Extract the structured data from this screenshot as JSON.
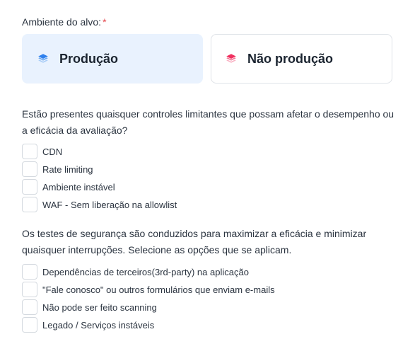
{
  "environment": {
    "label": "Ambiente do alvo:",
    "required_mark": "*",
    "options": [
      {
        "title": "Produção",
        "selected": true,
        "icon": "layers-icon",
        "icon_color": "#2f80ed"
      },
      {
        "title": "Não produção",
        "selected": false,
        "icon": "layers-icon",
        "icon_color": "#f0305f"
      }
    ]
  },
  "limiting_controls": {
    "question": "Estão presentes quaisquer controles limitantes que possam afetar o desempenho ou a eficácia da avaliação?",
    "options": [
      {
        "label": "CDN",
        "checked": false
      },
      {
        "label": "Rate limiting",
        "checked": false
      },
      {
        "label": "Ambiente instável",
        "checked": false
      },
      {
        "label": "WAF - Sem liberação na allowlist",
        "checked": false
      }
    ]
  },
  "testing_constraints": {
    "question": "Os testes de segurança são conduzidos para maximizar a eficácia e minimizar quaisquer interrupções. Selecione as opções que se aplicam.",
    "options": [
      {
        "label": "Dependências de terceiros(3rd-party) na aplicação",
        "checked": false
      },
      {
        "label": "\"Fale conosco\" ou outros formulários que enviam e-mails",
        "checked": false
      },
      {
        "label": "Não pode ser feito scanning",
        "checked": false
      },
      {
        "label": "Legado / Serviços instáveis",
        "checked": false
      }
    ]
  },
  "colors": {
    "selected_card_bg": "#e9f2fe",
    "card_border": "#dfe3e8",
    "required": "#e5484d"
  }
}
